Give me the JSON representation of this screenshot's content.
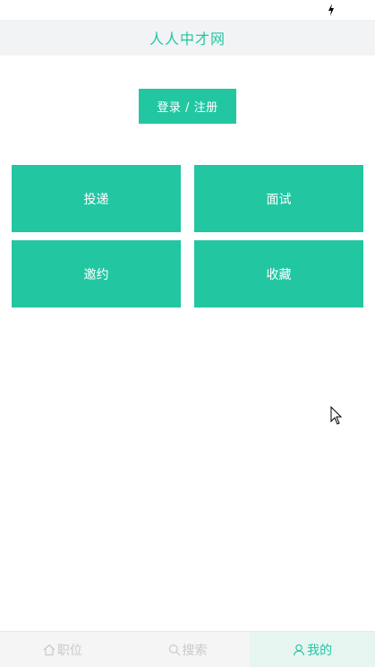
{
  "app": {
    "title": "人人中才网"
  },
  "auth": {
    "login_label": "登录 / 注册"
  },
  "grid": {
    "items": [
      {
        "label": "投递"
      },
      {
        "label": "面试"
      },
      {
        "label": "邀约"
      },
      {
        "label": "收藏"
      }
    ]
  },
  "tabbar": {
    "items": [
      {
        "label": "职位",
        "icon": "home-icon"
      },
      {
        "label": "搜索",
        "icon": "search-icon"
      },
      {
        "label": "我的",
        "icon": "user-icon",
        "active": true
      }
    ]
  },
  "colors": {
    "accent": "#22c7a2",
    "header_bg": "#f2f3f5",
    "tab_inactive": "#c9c9c9"
  }
}
